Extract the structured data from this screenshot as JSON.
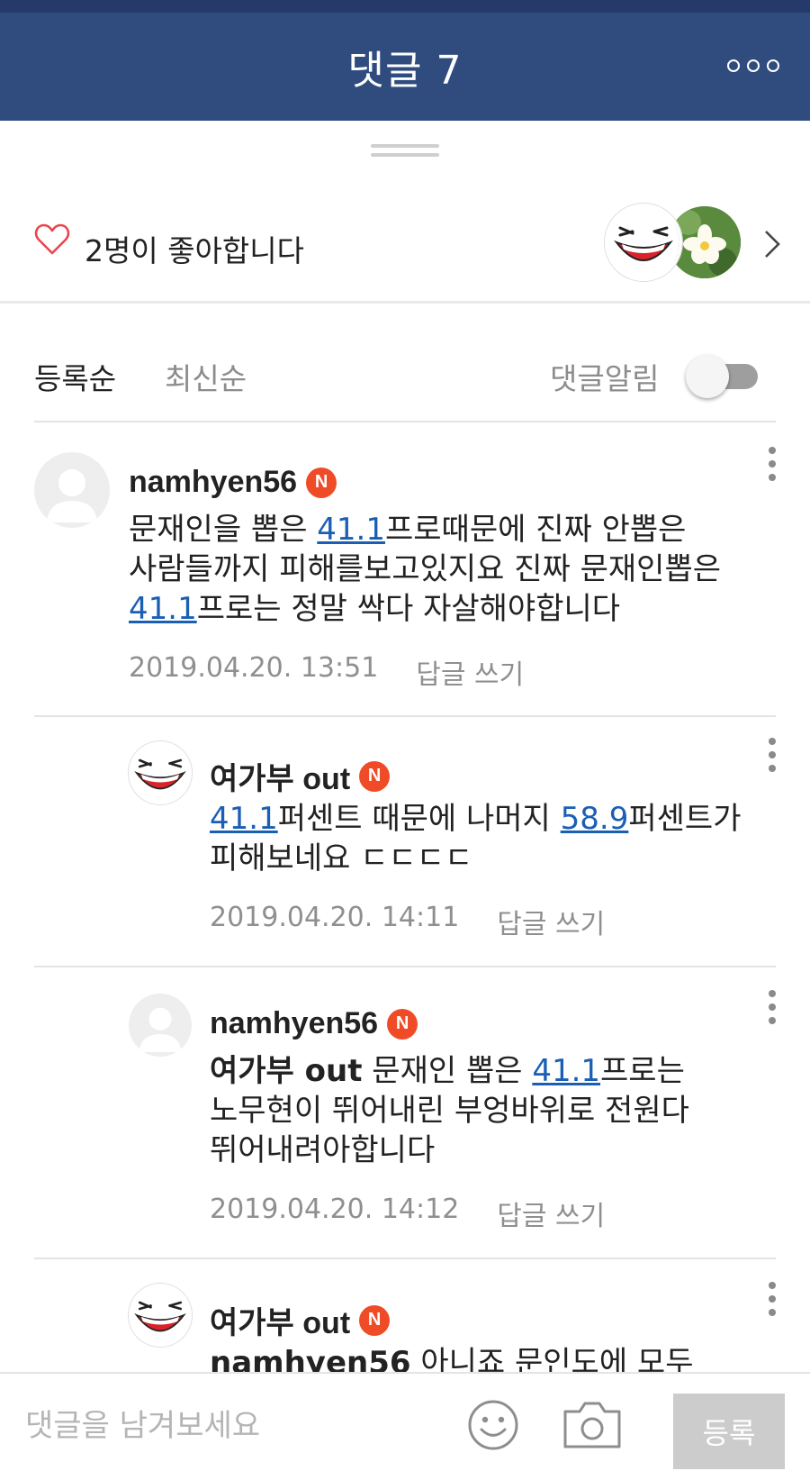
{
  "header": {
    "title": "댓글 7",
    "more_icon": "more-dots-icon",
    "bg_color": "#304c7e"
  },
  "likes": {
    "text": "2명이 좋아합니다",
    "heart_icon": "heart-outline-icon",
    "heart_color": "#e8464f"
  },
  "sort": {
    "registered": "등록순",
    "newest": "최신순",
    "notify_label": "댓글알림",
    "notify_on": false
  },
  "comments": [
    {
      "author": "namhyen56",
      "badge": "N",
      "parts": [
        {
          "t": "문재인을 뽑은 "
        },
        {
          "t": "41.1",
          "link": true
        },
        {
          "t": "프로때문에 진짜 안뽑은"
        },
        {
          "t": "사람들까지 피해를보고있지요 진짜 문재인뽑은"
        },
        {
          "t": "41.1",
          "link": true
        },
        {
          "t": "프로는 정말 싹다 자살해야합니다"
        }
      ],
      "date": "2019.04.20. 13:51",
      "reply_label": "답글 쓰기"
    },
    {
      "author": "여가부 out",
      "badge": "N",
      "parts": [
        {
          "t": "41.1",
          "link": true
        },
        {
          "t": "퍼센트 때문에 나머지 "
        },
        {
          "t": "58.9",
          "link": true
        },
        {
          "t": "퍼센트가"
        },
        {
          "t": "피해보네요 ㄷㄷㄷㄷ"
        }
      ],
      "date": "2019.04.20. 14:11",
      "reply_label": "답글 쓰기"
    },
    {
      "author": "namhyen56",
      "badge": "N",
      "parts": [
        {
          "t": "여가부 out",
          "bold": true
        },
        {
          "t": " 문재인 뽑은 "
        },
        {
          "t": "41.1",
          "link": true
        },
        {
          "t": "프로는"
        },
        {
          "t": "노무현이 뛰어내린 부엉바위로 전원다"
        },
        {
          "t": "뛰어내려아합니다"
        }
      ],
      "date": "2019.04.20. 14:12",
      "reply_label": "답글 쓰기"
    },
    {
      "author": "여가부 out",
      "badge": "N",
      "parts": [
        {
          "t": "namhyen56",
          "bold": true
        },
        {
          "t": " 아니죠 문인도에 모두"
        }
      ]
    }
  ],
  "composer": {
    "placeholder": "댓글을 남겨보세요",
    "submit_label": "등록",
    "emoji_icon": "smiley-icon",
    "camera_icon": "camera-icon"
  }
}
